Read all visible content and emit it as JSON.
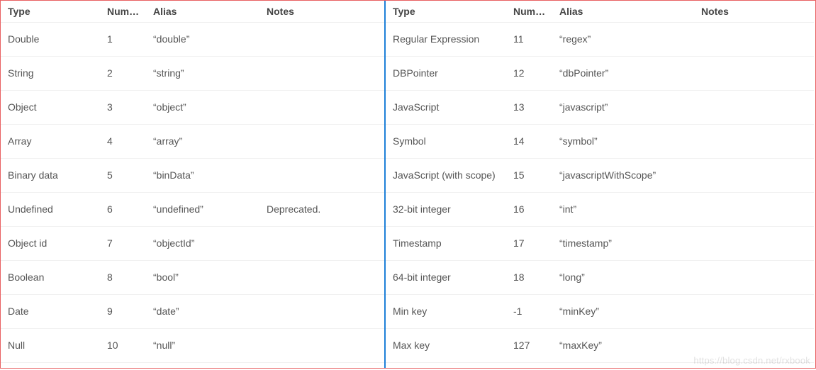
{
  "columns": {
    "type": "Type",
    "number": "Number",
    "alias": "Alias",
    "notes": "Notes"
  },
  "left": [
    {
      "type": "Double",
      "number": "1",
      "alias": "“double”",
      "notes": ""
    },
    {
      "type": "String",
      "number": "2",
      "alias": "“string”",
      "notes": ""
    },
    {
      "type": "Object",
      "number": "3",
      "alias": "“object”",
      "notes": ""
    },
    {
      "type": "Array",
      "number": "4",
      "alias": "“array”",
      "notes": ""
    },
    {
      "type": "Binary data",
      "number": "5",
      "alias": "“binData”",
      "notes": ""
    },
    {
      "type": "Undefined",
      "number": "6",
      "alias": "“undefined”",
      "notes": "Deprecated."
    },
    {
      "type": "Object id",
      "number": "7",
      "alias": "“objectId”",
      "notes": ""
    },
    {
      "type": "Boolean",
      "number": "8",
      "alias": "“bool”",
      "notes": ""
    },
    {
      "type": "Date",
      "number": "9",
      "alias": "“date”",
      "notes": ""
    },
    {
      "type": "Null",
      "number": "10",
      "alias": "“null”",
      "notes": ""
    }
  ],
  "right": [
    {
      "type": "Regular Expression",
      "number": "11",
      "alias": "“regex”",
      "notes": ""
    },
    {
      "type": "DBPointer",
      "number": "12",
      "alias": "“dbPointer”",
      "notes": ""
    },
    {
      "type": "JavaScript",
      "number": "13",
      "alias": "“javascript”",
      "notes": ""
    },
    {
      "type": "Symbol",
      "number": "14",
      "alias": "“symbol”",
      "notes": ""
    },
    {
      "type": "JavaScript (with scope)",
      "number": "15",
      "alias": "“javascriptWithScope”",
      "notes": ""
    },
    {
      "type": "32-bit integer",
      "number": "16",
      "alias": "“int”",
      "notes": ""
    },
    {
      "type": "Timestamp",
      "number": "17",
      "alias": "“timestamp”",
      "notes": ""
    },
    {
      "type": "64-bit integer",
      "number": "18",
      "alias": "“long”",
      "notes": ""
    },
    {
      "type": "Min key",
      "number": "-1",
      "alias": "“minKey”",
      "notes": ""
    },
    {
      "type": "Max key",
      "number": "127",
      "alias": "“maxKey”",
      "notes": ""
    }
  ],
  "watermark": "https://blog.csdn.net/rxbook"
}
